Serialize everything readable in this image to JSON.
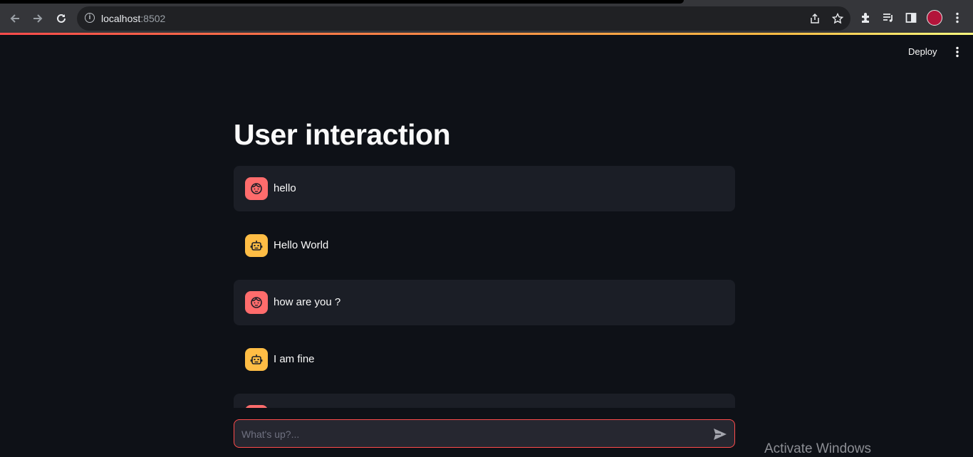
{
  "browser": {
    "url_host": "localhost",
    "url_port": ":8502"
  },
  "app": {
    "deploy_label": "Deploy",
    "title": "User interaction"
  },
  "messages": [
    {
      "role": "user",
      "text": "hello",
      "icon": "face-icon"
    },
    {
      "role": "assistant",
      "text": "Hello World",
      "icon": "robot-icon"
    },
    {
      "role": "user",
      "text": "how are you ?",
      "icon": "face-icon"
    },
    {
      "role": "assistant",
      "text": "I am fine",
      "icon": "robot-icon"
    },
    {
      "role": "user",
      "text": "",
      "icon": "face-icon"
    }
  ],
  "chat_input": {
    "placeholder": "What's up?..."
  },
  "os": {
    "watermark": "Activate Windows"
  },
  "colors": {
    "background": "#0e1117",
    "user_avatar": "#ff6c6c",
    "bot_avatar": "#ffbd45",
    "accent": "#ff4b4b"
  }
}
